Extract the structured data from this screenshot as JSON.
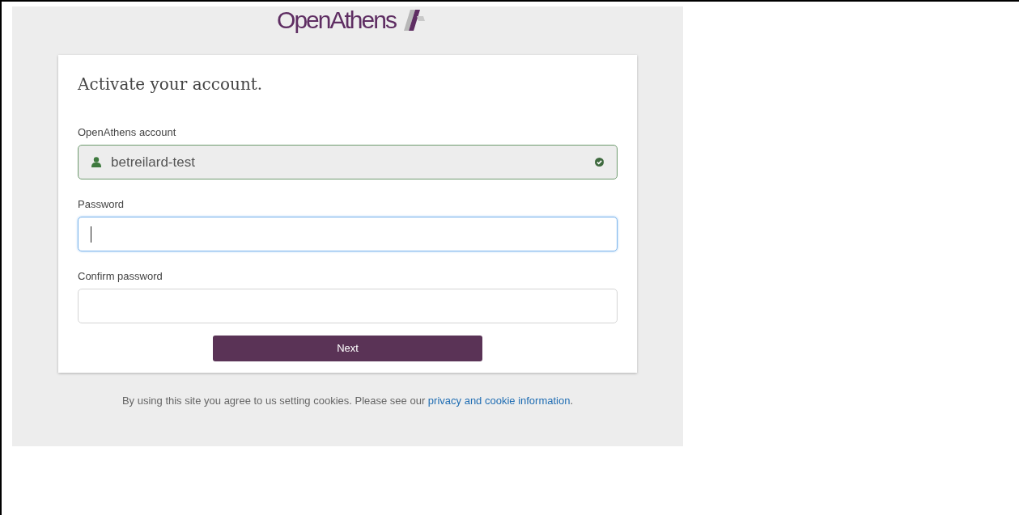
{
  "logo": {
    "text": "OpenAthens"
  },
  "card": {
    "title": "Activate your account.",
    "fields": [
      {
        "label": "OpenAthens account",
        "value": "betreilard-test",
        "kind": "account",
        "valid": true,
        "focused": false
      },
      {
        "label": "Password",
        "kind": "password",
        "focused": true
      },
      {
        "label": "Confirm password",
        "kind": "password",
        "focused": false
      }
    ],
    "button": "Next"
  },
  "footer": {
    "text": "By using this site you agree to us setting cookies. Please see our",
    "link": "privacy and cookie information",
    "after": "."
  }
}
